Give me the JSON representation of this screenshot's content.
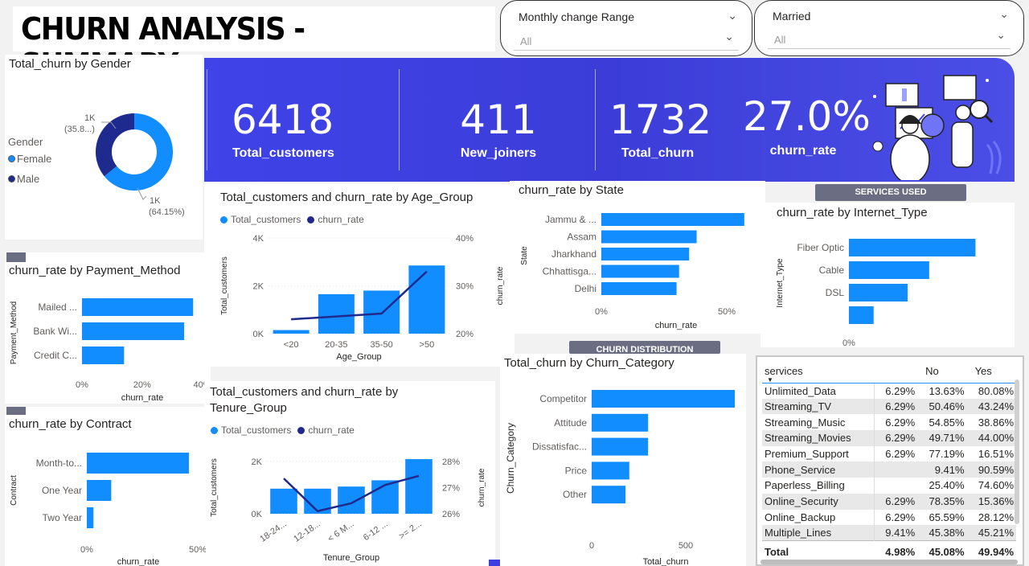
{
  "header": {
    "title": "CHURN ANALYSIS - SUMMARY"
  },
  "slicers": [
    {
      "label": "Monthly change Range",
      "value": "All"
    },
    {
      "label": "Married",
      "value": "All"
    }
  ],
  "kpis": [
    {
      "value": "6418",
      "label": "Total_customers"
    },
    {
      "value": "411",
      "label": "New_joiners"
    },
    {
      "value": "1732",
      "label": "Total_churn"
    },
    {
      "value": "27.0%",
      "label": "churn_rate"
    }
  ],
  "colors": {
    "bar": "#118dff",
    "line": "#1f2a8c",
    "kpi_bg": "#3d3fe0",
    "male": "#1e2a8e"
  },
  "tags": {
    "services_used": "SERVICES USED",
    "churn_distribution": "CHURN DISTRIBUTION"
  },
  "gender_chart": {
    "title": "Total_churn by Gender",
    "legend_title": "Gender",
    "legend": [
      "Female",
      "Male"
    ],
    "labels": [
      {
        "value": "1K",
        "pct": "(35.8...)"
      },
      {
        "value": "1K",
        "pct": "(64.15%)"
      }
    ]
  },
  "chart_data": [
    {
      "id": "gender",
      "type": "pie",
      "title": "Total_churn by Gender",
      "categories": [
        "Female",
        "Male"
      ],
      "values": [
        64.15,
        35.85
      ]
    },
    {
      "id": "age",
      "type": "bar",
      "title": "Total_customers and churn_rate by Age_Group",
      "legend": [
        "Total_customers",
        "churn_rate"
      ],
      "categories": [
        "<20",
        "20-35",
        "35-50",
        ">50"
      ],
      "xlabel": "Age_Group",
      "ylabel": "Total_customers",
      "y2label": "churn_rate",
      "yticks": [
        "0K",
        "2K",
        "4K"
      ],
      "y2ticks": [
        "20%",
        "30%",
        "40%"
      ],
      "ylim": [
        0,
        4000
      ],
      "y2lim": [
        20,
        40
      ],
      "series": [
        {
          "name": "Total_customers",
          "values": [
            150,
            1650,
            1800,
            2850
          ]
        },
        {
          "name": "churn_rate",
          "values": [
            23,
            23.6,
            24.2,
            33
          ]
        }
      ]
    },
    {
      "id": "tenure",
      "type": "bar",
      "title": "Total_customers and churn_rate by Tenure_Group",
      "title_lines": [
        "Total_customers and churn_rate by",
        "Tenure_Group"
      ],
      "legend": [
        "Total_customers",
        "churn_rate"
      ],
      "categories": [
        "18-24...",
        "12-18...",
        "< 6 M...",
        "6-12 ...",
        ">= 2..."
      ],
      "xlabel": "Tenure_Group",
      "ylabel": "Total_customers",
      "y2label": "churn_rate",
      "yticks": [
        "0K",
        "2K"
      ],
      "y2ticks": [
        "26%",
        "27%",
        "28%"
      ],
      "ylim": [
        0,
        2000
      ],
      "y2lim": [
        26,
        28
      ],
      "series": [
        {
          "name": "Total_customers",
          "values": [
            960,
            960,
            1040,
            1280,
            2090
          ]
        },
        {
          "name": "churn_rate",
          "values": [
            27.35,
            26.1,
            26.4,
            27.1,
            27.45
          ]
        }
      ]
    },
    {
      "id": "payment",
      "type": "bar",
      "title": "churn_rate by Payment_Method",
      "categories": [
        "Mailed ...",
        "Bank Wi...",
        "Credit C..."
      ],
      "values": [
        37,
        34,
        14
      ],
      "xlabel": "churn_rate",
      "ylabel": "Payment_Method",
      "xticks": [
        "0%",
        "20%",
        "40%"
      ],
      "xlim": [
        0,
        38
      ]
    },
    {
      "id": "contract",
      "type": "bar",
      "title": "churn_rate by Contract",
      "categories": [
        "Month-to...",
        "One Year",
        "Two Year"
      ],
      "values": [
        46,
        11,
        3
      ],
      "xlabel": "churn_rate",
      "ylabel": "Contract",
      "xticks": [
        "0%",
        "50%"
      ],
      "xlim": [
        0,
        50
      ]
    },
    {
      "id": "state",
      "type": "bar",
      "title": "churn_rate by State",
      "categories": [
        "Jammu & ...",
        "Assam",
        "Jharkhand",
        "Chhattisga...",
        "Delhi"
      ],
      "values": [
        57,
        38,
        35,
        31,
        30
      ],
      "xlabel": "churn_rate",
      "ylabel": "State",
      "xticks": [
        "0%",
        "50%"
      ],
      "xlim": [
        0,
        50
      ]
    },
    {
      "id": "internet",
      "type": "bar",
      "title": "churn_rate by Internet_Type",
      "categories": [
        "Fiber Optic",
        "Cable",
        "DSL",
        ""
      ],
      "values": [
        41,
        26,
        19,
        8
      ],
      "xlabel": "",
      "ylabel": "Internet_Type",
      "xticks": [
        "0%"
      ],
      "xlim": [
        0,
        50
      ]
    },
    {
      "id": "category",
      "type": "bar",
      "title": "Total_churn by Churn_Category",
      "categories": [
        "Competitor",
        "Attitude",
        "Dissatisfac...",
        "Price",
        "Other"
      ],
      "values": [
        761,
        300,
        300,
        200,
        180
      ],
      "xlabel": "Total_churn",
      "ylabel": "Churn_Category",
      "xticks": [
        "0",
        "500"
      ],
      "xlim": [
        0,
        500
      ]
    }
  ],
  "services_table": {
    "headers": [
      "services",
      "No",
      "Yes"
    ],
    "rows": [
      [
        "Unlimited_Data",
        "6.29%",
        "13.63%",
        "80.08%"
      ],
      [
        "Streaming_TV",
        "6.29%",
        "50.46%",
        "43.24%"
      ],
      [
        "Streaming_Music",
        "6.29%",
        "54.85%",
        "38.86%"
      ],
      [
        "Streaming_Movies",
        "6.29%",
        "49.71%",
        "44.00%"
      ],
      [
        "Premium_Support",
        "6.29%",
        "77.19%",
        "16.51%"
      ],
      [
        "Phone_Service",
        "",
        "9.41%",
        "90.59%"
      ],
      [
        "Paperless_Billing",
        "",
        "25.40%",
        "74.60%"
      ],
      [
        "Online_Security",
        "6.29%",
        "78.35%",
        "15.36%"
      ],
      [
        "Online_Backup",
        "6.29%",
        "65.59%",
        "28.12%"
      ],
      [
        "Multiple_Lines",
        "9.41%",
        "45.38%",
        "45.21%"
      ]
    ],
    "total": [
      "Total",
      "4.98%",
      "45.08%",
      "49.94%"
    ]
  }
}
